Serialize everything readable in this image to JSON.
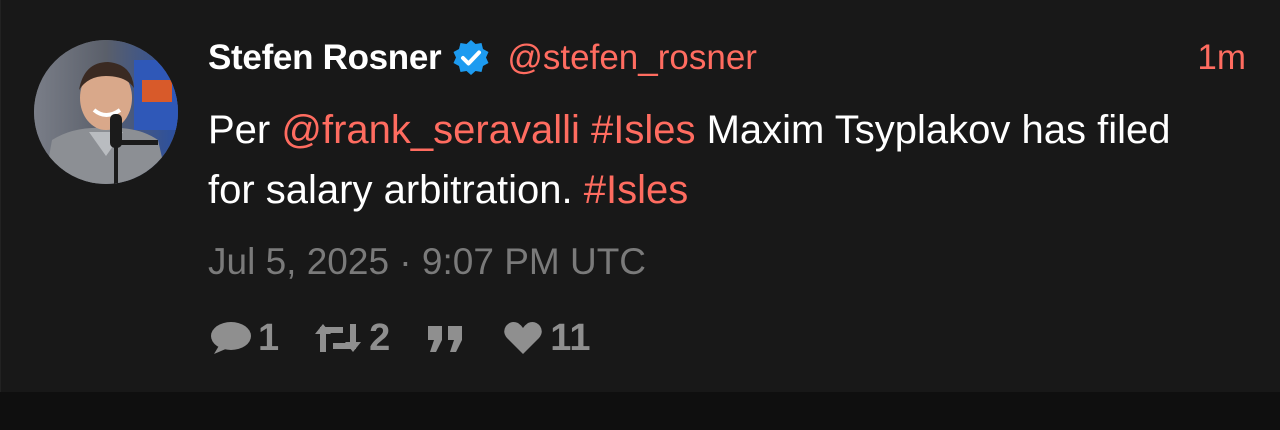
{
  "tweet": {
    "fullname": "Stefen Rosner",
    "handle": "@stefen_rosner",
    "time_ago": "1m",
    "body": {
      "prefix": "Per ",
      "mention": "@frank_seravalli",
      "space1": " ",
      "hashtag1": "#Isles",
      "middle": " Maxim Tsyplakov has filed for salary arbitration. ",
      "hashtag2": "#Isles"
    },
    "date": "Jul 5, 2025 · 9:07 PM UTC",
    "stats": {
      "comments": "1",
      "retweets": "2",
      "likes": "11"
    },
    "icons": {
      "verified": "verified-badge-icon",
      "comment": "comment-icon",
      "retweet": "retweet-icon",
      "quote": "quote-icon",
      "like": "heart-icon"
    },
    "colors": {
      "accent": "#ff6c60",
      "verified": "#1d9bf0",
      "background": "#181818",
      "muted": "#7a7a7a"
    }
  }
}
